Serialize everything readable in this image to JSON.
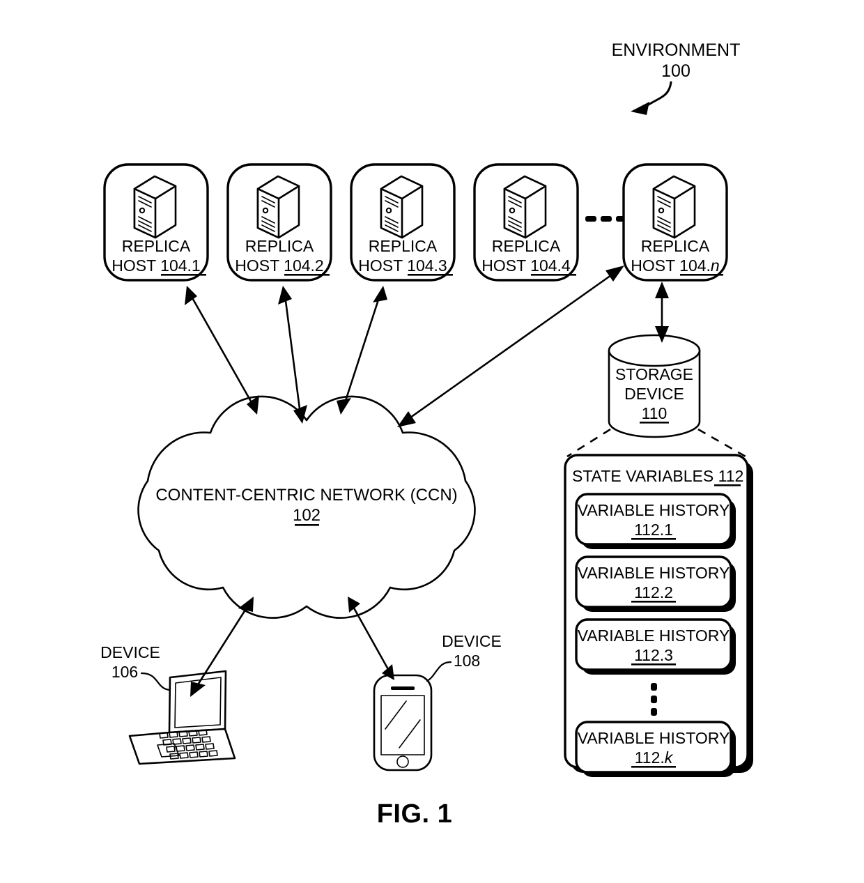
{
  "figure": {
    "caption": "FIG. 1",
    "environment_label": "ENVIRONMENT",
    "environment_ref": "100"
  },
  "replica_hosts": [
    {
      "line1": "REPLICA",
      "line2_prefix": "HOST ",
      "ref": "104.1",
      "ref_suffix": ""
    },
    {
      "line1": "REPLICA",
      "line2_prefix": "HOST ",
      "ref": "104.2",
      "ref_suffix": ""
    },
    {
      "line1": "REPLICA",
      "line2_prefix": "HOST ",
      "ref": "104.3",
      "ref_suffix": ""
    },
    {
      "line1": "REPLICA",
      "line2_prefix": "HOST ",
      "ref": "104.4",
      "ref_suffix": ""
    },
    {
      "line1": "REPLICA",
      "line2_prefix": "HOST ",
      "ref": "104.",
      "ref_suffix": "n"
    }
  ],
  "host_ellipsis": "•••",
  "network": {
    "label": "CONTENT-CENTRIC NETWORK (CCN)",
    "ref": "102"
  },
  "storage": {
    "line1": "STORAGE",
    "line2": "DEVICE",
    "ref": "110"
  },
  "state_variables": {
    "title": "STATE VARIABLES ",
    "ref": "112",
    "items": [
      {
        "label": "VARIABLE HISTORY",
        "ref": "112.1",
        "ref_suffix": ""
      },
      {
        "label": "VARIABLE HISTORY",
        "ref": "112.2",
        "ref_suffix": ""
      },
      {
        "label": "VARIABLE HISTORY",
        "ref": "112.3",
        "ref_suffix": ""
      },
      {
        "label": "VARIABLE HISTORY",
        "ref": "112.",
        "ref_suffix": "k"
      }
    ],
    "vertical_ellipsis": "⋮"
  },
  "devices": [
    {
      "label": "DEVICE",
      "ref": "106",
      "kind": "laptop"
    },
    {
      "label": "DEVICE",
      "ref": "108",
      "kind": "phone"
    }
  ],
  "colors": {
    "line": "#000000",
    "background": "#ffffff"
  }
}
